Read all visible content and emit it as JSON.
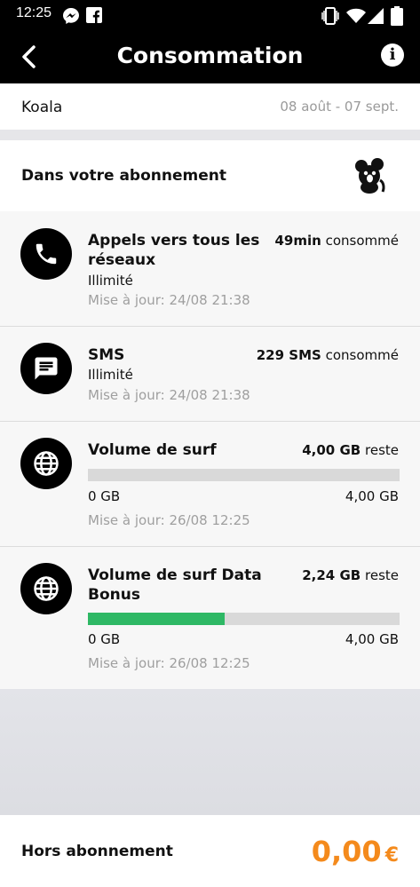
{
  "status_bar": {
    "time": "12:25"
  },
  "app_bar": {
    "title": "Consommation"
  },
  "plan": {
    "name": "Koala",
    "period": "08 août - 07 sept."
  },
  "subscription": {
    "label": "Dans votre abonnement"
  },
  "cards": [
    {
      "title_line1": "Appels vers tous les",
      "title_line2": "réseaux",
      "amount": "49min",
      "amount_suffix": "consommé",
      "subtitle": "Illimité",
      "updated": "Mise à jour: 24/08 21:38",
      "icon": "phone-icon"
    },
    {
      "title_line1": "SMS",
      "amount": "229 SMS",
      "amount_suffix": "consommé",
      "subtitle": "Illimité",
      "updated": "Mise à jour: 24/08 21:38",
      "icon": "message-icon"
    },
    {
      "title_line1": "Volume de surf",
      "amount": "4,00 GB",
      "amount_suffix": "reste",
      "progress": 0,
      "min_label": "0 GB",
      "max_label": "4,00 GB",
      "updated": "Mise à jour: 26/08 12:25",
      "icon": "globe-icon"
    },
    {
      "title_line1": "Volume de surf Data",
      "title_line2": "Bonus",
      "amount": "2,24 GB",
      "amount_suffix": "reste",
      "progress": 0.44,
      "min_label": "0 GB",
      "max_label": "4,00 GB",
      "updated": "Mise à jour: 26/08 12:25",
      "icon": "globe-icon"
    }
  ],
  "hors_abonnement": {
    "label": "Hors abonnement",
    "amount": "0,00",
    "currency": "€"
  },
  "colors": {
    "accent_orange": "#f48a1c",
    "progress_green": "#2eb865",
    "header_bg": "#000000"
  }
}
